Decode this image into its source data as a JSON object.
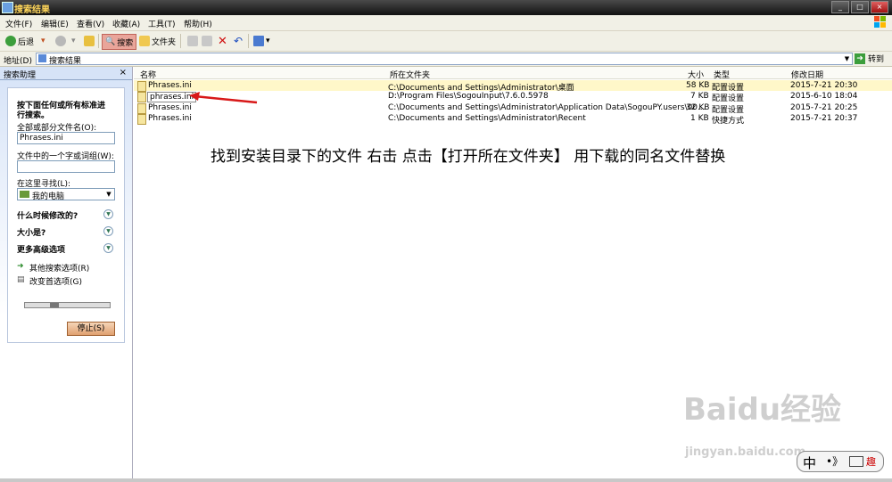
{
  "window": {
    "title": "搜索结果",
    "controls": [
      "_",
      "□",
      "×"
    ]
  },
  "menu": [
    "文件(F)",
    "编辑(E)",
    "查看(V)",
    "收藏(A)",
    "工具(T)",
    "帮助(H)"
  ],
  "toolbar": {
    "back": "后退",
    "search": "搜索",
    "folders": "文件夹"
  },
  "address": {
    "label": "地址(D)",
    "value": "搜索结果",
    "go": "转到"
  },
  "sidebar": {
    "title": "搜索助理",
    "prompt_line1": "按下面任何或所有标准进",
    "prompt_line2": "行搜索。",
    "filename_label": "全部或部分文件名(O):",
    "filename_value": "Phrases.ini",
    "phrase_label": "文件中的一个字或词组(W):",
    "phrase_value": "",
    "lookin_label": "在这里寻找(L):",
    "lookin_value": "我的电脑",
    "when_modified": "什么时候修改的?",
    "size": "大小是?",
    "advanced": "更多高级选项",
    "other_search": "其他搜索选项(R)",
    "change_prefs": "改变首选项(G)",
    "stop": "停止(S)"
  },
  "columns": {
    "name": "名称",
    "folder": "所在文件夹",
    "size": "大小",
    "type": "类型",
    "modified": "修改日期"
  },
  "rows": [
    {
      "name": "Phrases.ini",
      "folder": "C:\\Documents and Settings\\Administrator\\桌面",
      "size": "58 KB",
      "type": "配置设置",
      "modified": "2015-7-21 20:30"
    },
    {
      "name": "phrases.ini",
      "folder": "D:\\Program Files\\SogouInput\\7.6.0.5978",
      "size": "7 KB",
      "type": "配置设置",
      "modified": "2015-6-10 18:04"
    },
    {
      "name": "Phrases.ini",
      "folder": "C:\\Documents and Settings\\Administrator\\Application Data\\SogouPY.users\\00...",
      "size": "32 KB",
      "type": "配置设置",
      "modified": "2015-7-21 20:25"
    },
    {
      "name": "Phrases.ini",
      "folder": "C:\\Documents and Settings\\Administrator\\Recent",
      "size": "1 KB",
      "type": "快捷方式",
      "modified": "2015-7-21 20:37"
    }
  ],
  "annotation": "找到安装目录下的文件 右击 点击【打开所在文件夹】 用下载的同名文件替换",
  "watermark": {
    "main": "Baidu经验",
    "sub": "jingyan.baidu.com"
  },
  "ime": {
    "lang": "中",
    "mode": "•》",
    "extra": "趣"
  }
}
